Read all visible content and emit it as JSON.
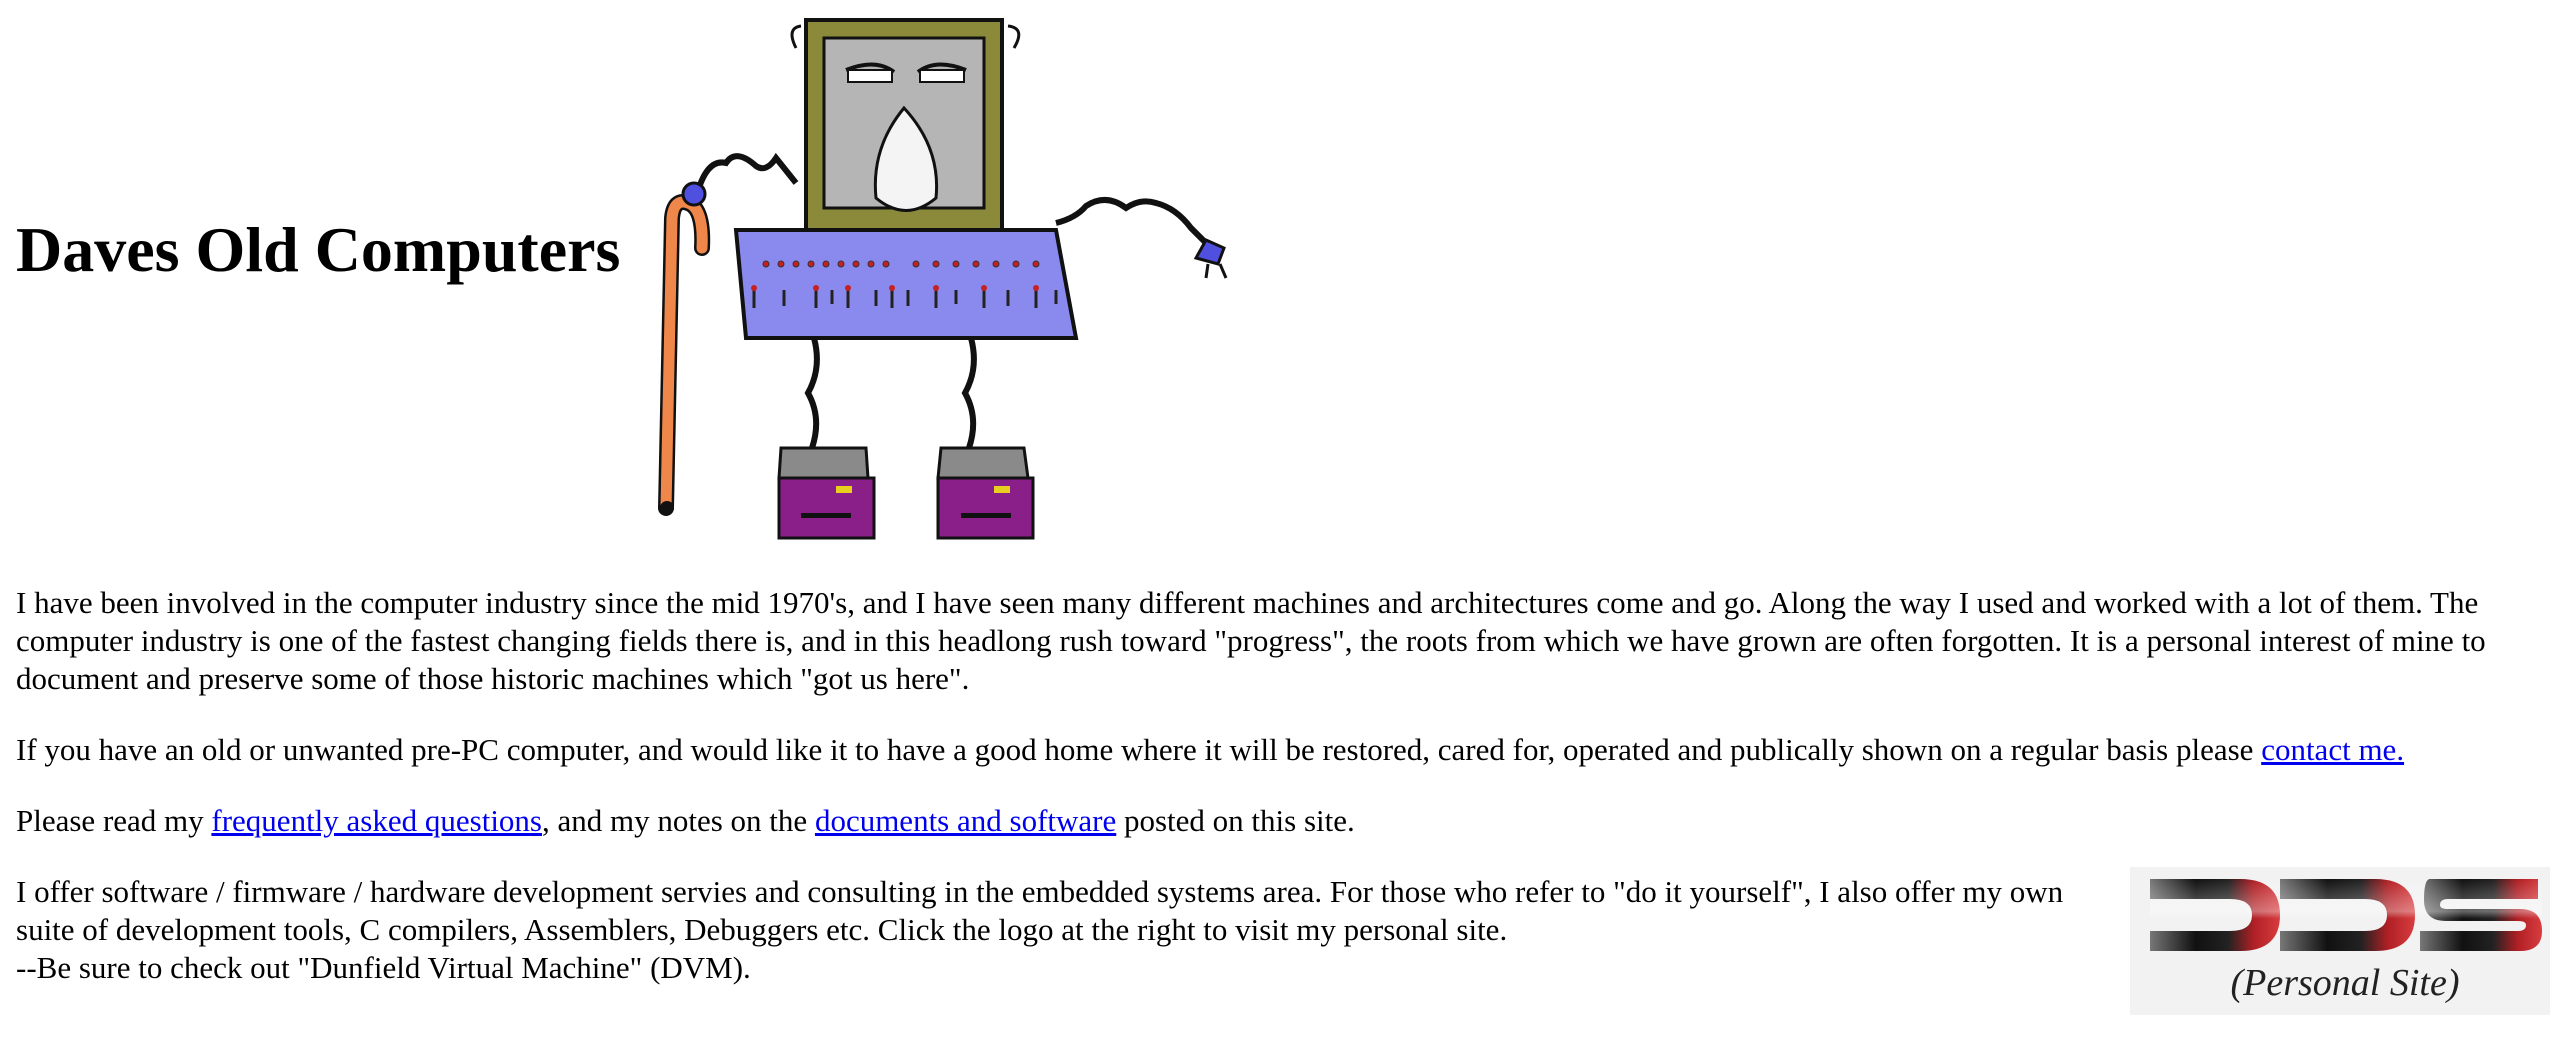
{
  "header": {
    "title": "Daves Old Computers",
    "mascot_icon": "old-computer-mascot-icon"
  },
  "intro": {
    "paragraph": "I have been involved in the computer industry since the mid 1970's, and I have seen many different machines and architectures come and go. Along the way I used and worked with a lot of them. The computer industry is one of the fastest changing fields there is, and in this headlong rush toward \"progress\", the roots from which we have grown are often forgotten. It is a personal interest of mine to document and preserve some of those historic machines which \"got us here\"."
  },
  "donate": {
    "text": "If you have an old or unwanted pre-PC computer, and would like it to have a good home where it will be restored, cared for, operated and publically shown on a regular basis please ",
    "link_label": "contact me."
  },
  "faq": {
    "prefix": "Please read my ",
    "faq_link": "frequently asked questions",
    "middle": ", and my notes on the ",
    "docs_link": "documents and software",
    "suffix": " posted on this site."
  },
  "services": {
    "line1": "I offer software / firmware / hardware development servies and consulting in the embedded systems area. For those who refer to \"do it yourself\", I also offer my own suite of development tools, C compilers, Assemblers, Debuggers etc. Click the logo at the right to visit my personal site.",
    "line2": "--Be sure to check out \"Dunfield Virtual Machine\" (DVM)."
  },
  "logo": {
    "caption": "(Personal Site)",
    "icon": "dds-logo-icon"
  },
  "colors": {
    "link": "#0000ee",
    "mascot_monitor": "#8a8a3a",
    "mascot_body": "#8a8aee",
    "mascot_feet": "#8a1f8a",
    "cane": "#f0874a",
    "logo_red": "#c0282b"
  }
}
